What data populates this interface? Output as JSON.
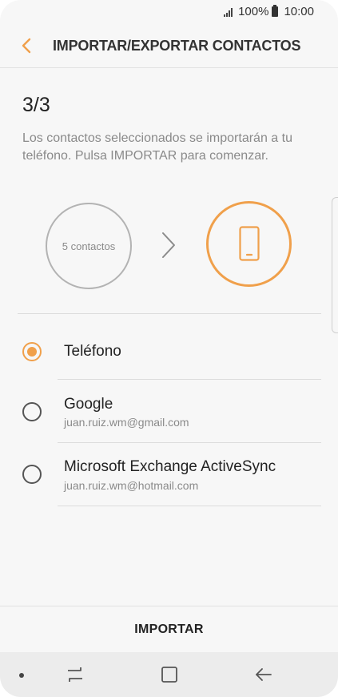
{
  "status_bar": {
    "battery": "100%",
    "time": "10:00",
    "icons": [
      "signal-icon",
      "battery-icon"
    ]
  },
  "header": {
    "title": "IMPORTAR/EXPORTAR CONTACTOS",
    "back_icon": "chevron-left-icon"
  },
  "step": "3/3",
  "description": "Los contactos seleccionados se importarán a tu teléfono. Pulsa IMPORTAR para comenzar.",
  "illustration": {
    "source_label": "5 contactos",
    "arrow_icon": "chevron-right-icon",
    "target_icon": "phone-icon"
  },
  "options": [
    {
      "label": "Teléfono",
      "sub": "",
      "selected": true
    },
    {
      "label": "Google",
      "sub": "juan.ruiz.wm@gmail.com",
      "selected": false
    },
    {
      "label": "Microsoft Exchange ActiveSync",
      "sub": "juan.ruiz.wm@hotmail.com",
      "selected": false
    }
  ],
  "action": {
    "import_label": "IMPORTAR"
  },
  "nav_bar": {
    "icons": [
      "dot-icon",
      "recent-apps-icon",
      "home-icon",
      "back-arrow-icon"
    ]
  },
  "colors": {
    "accent": "#f0a04b",
    "background": "#f7f7f7",
    "text_secondary": "#8a8a8a"
  }
}
